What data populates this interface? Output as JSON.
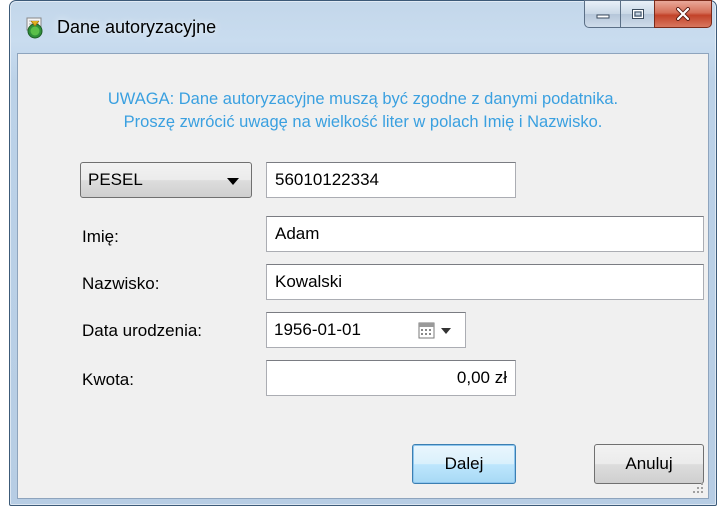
{
  "window": {
    "title": "Dane autoryzacyjne",
    "app_icon": "tax-app-icon",
    "caption_icons": [
      "minimize-icon",
      "maximize-icon",
      "close-icon"
    ]
  },
  "warning": {
    "line1": "UWAGA: Dane autoryzacyjne muszą być zgodne z danymi podatnika.",
    "line2": "Proszę zwrócić uwagę na wielkość liter w polach Imię i Nazwisko.",
    "color": "#3aa0e0"
  },
  "form": {
    "id_type": {
      "selected": "PESEL"
    },
    "id_value": "56010122334",
    "first_name_label": "Imię:",
    "first_name": "Adam",
    "last_name_label": "Nazwisko:",
    "last_name": "Kowalski",
    "birth_date_label": "Data urodzenia:",
    "birth_date": "1956-01-01",
    "amount_label": "Kwota:",
    "amount": "0,00 zł"
  },
  "buttons": {
    "next": "Dalej",
    "cancel": "Anuluj"
  }
}
